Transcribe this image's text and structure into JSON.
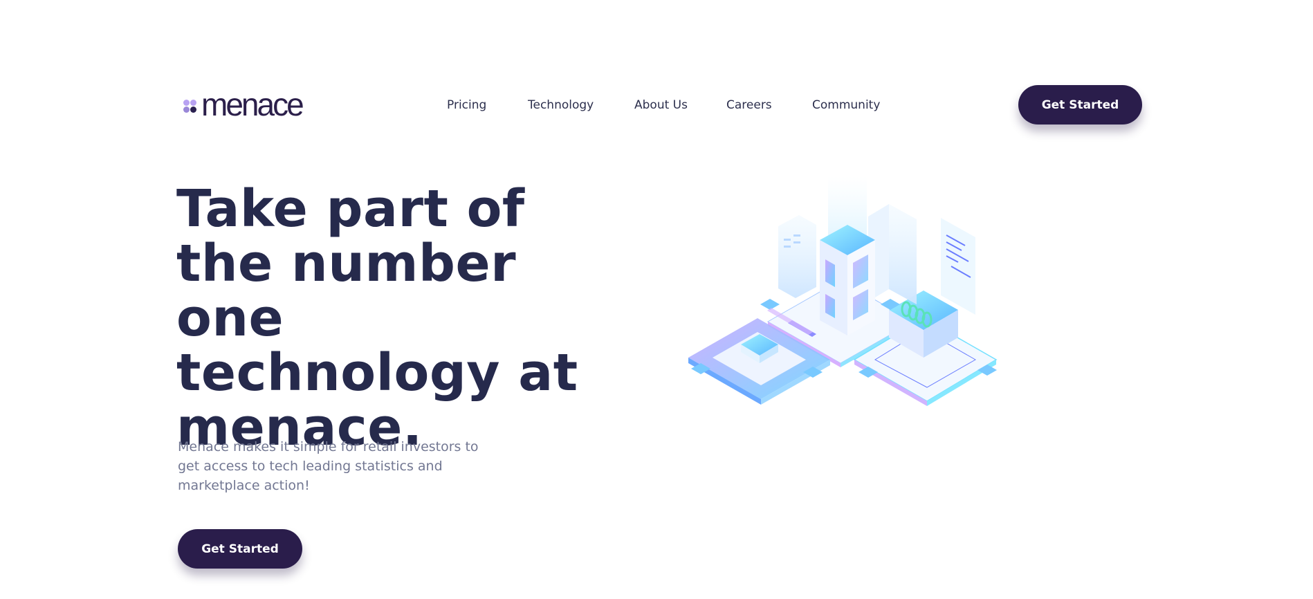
{
  "brand": {
    "name": "menace"
  },
  "nav": {
    "items": [
      {
        "label": "Pricing"
      },
      {
        "label": "Technology"
      },
      {
        "label": "About Us"
      },
      {
        "label": "Careers"
      },
      {
        "label": "Community"
      }
    ]
  },
  "header": {
    "cta_label": "Get Started"
  },
  "hero": {
    "title": "Take part of the number one technology at menace.",
    "subtitle": "Menace makes it simple for retail investors to get access to tech leading statistics and marketplace action!",
    "cta_label": "Get Started"
  },
  "colors": {
    "primary": "#2a1d4b",
    "heading": "#262a4c",
    "body_text": "#727792",
    "logo_dot_light": "#b8a2f2"
  },
  "illustration": {
    "icon": "isometric-tech-city-illustration"
  }
}
